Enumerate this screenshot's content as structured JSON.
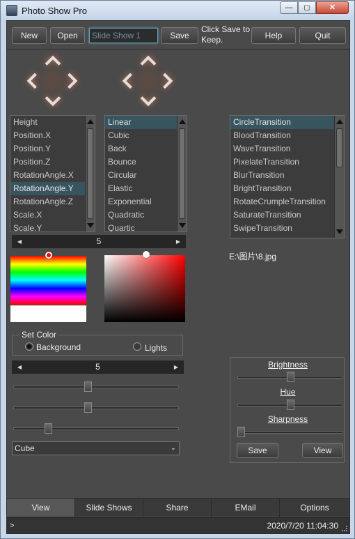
{
  "window": {
    "title": "Photo Show Pro",
    "min_glyph": "—",
    "max_glyph": "◻",
    "close_glyph": "✕"
  },
  "toolbar": {
    "new_label": "New",
    "open_label": "Open",
    "slideshow_name": "Slide Show 1",
    "save_label": "Save",
    "save_hint": "Click Save to Keep.",
    "help_label": "Help",
    "quit_label": "Quit"
  },
  "properties": {
    "items": [
      "Height",
      "Position.X",
      "Position.Y",
      "Position.Z",
      "RotationAngle.X",
      "RotationAngle.Y",
      "RotationAngle.Z",
      "Scale.X",
      "Scale.Y"
    ],
    "selected": 5
  },
  "easings": {
    "items": [
      "Linear",
      "Cubic",
      "Back",
      "Bounce",
      "Circular",
      "Elastic",
      "Exponential",
      "Quadratic",
      "Quartic"
    ],
    "selected": 0
  },
  "transitions": {
    "items": [
      "CircleTransition",
      "BloodTransition",
      "WaveTransition",
      "PixelateTransition",
      "BlurTransition",
      "BrightTransition",
      "RotateCrumpleTransition",
      "SaturateTransition",
      "SwipeTransition"
    ],
    "selected": 0
  },
  "stepper1": {
    "value": "5",
    "left": "◀",
    "right": "▶"
  },
  "stepper2": {
    "value": "5",
    "left": "◀",
    "right": "▶"
  },
  "file_path": "E:\\图片\\8.jpg",
  "set_color": {
    "title": "Set Color",
    "background_label": "Background",
    "lights_label": "Lights",
    "selected": "Background"
  },
  "sliders": {
    "slider1": 0.45,
    "slider2": 0.45,
    "slider3": 0.2
  },
  "shape_select": {
    "value": "Cube",
    "chevron": "⌄"
  },
  "adjust": {
    "brightness_label": "Brightness",
    "brightness": 0.5,
    "hue_label": "Hue",
    "hue": 0.5,
    "sharpness_label": "Sharpness",
    "sharpness": 0.0,
    "save_label": "Save",
    "view_label": "View"
  },
  "tabs": [
    "View",
    "Slide Shows",
    "Share",
    "EMail",
    "Options"
  ],
  "active_tab": "View",
  "status": {
    "prompt": ">",
    "datetime": "2020/7/20 11:04:30"
  },
  "colors": {
    "panel": "#4a4a4a",
    "selection": "#37545f",
    "accent_glow": "#d9704a"
  }
}
